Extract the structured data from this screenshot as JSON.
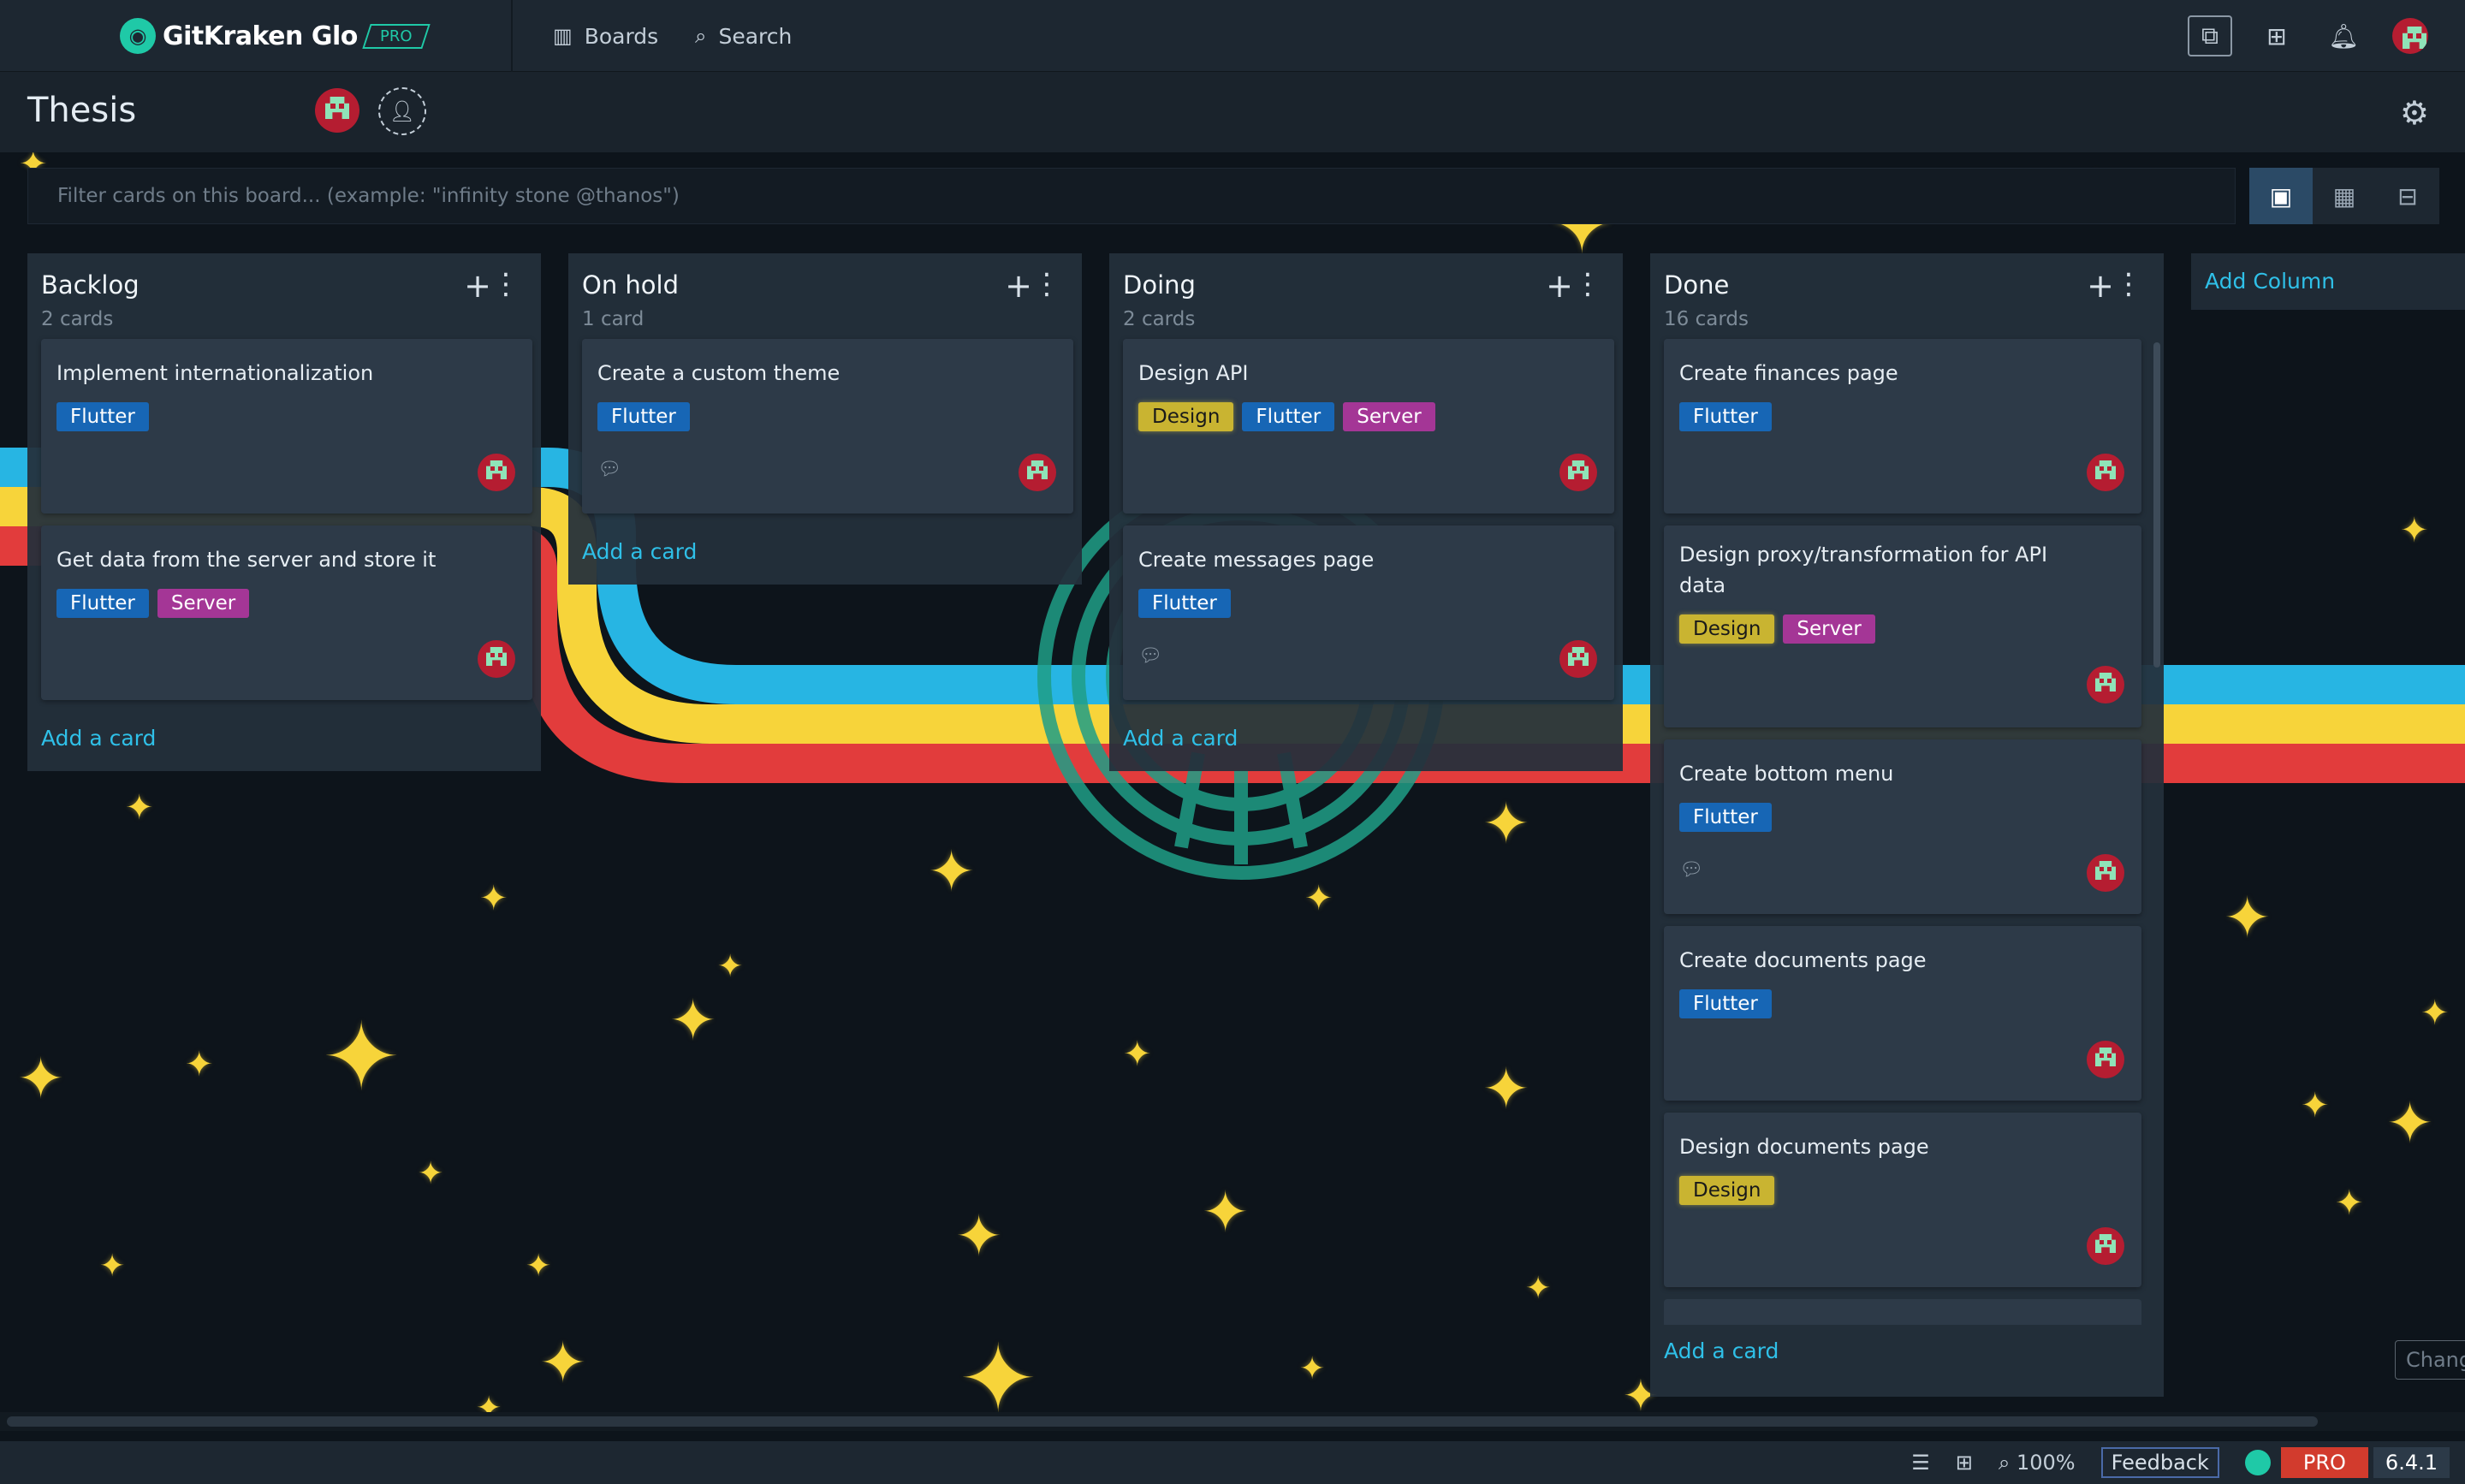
{
  "app": {
    "logo_text": "GitKraken Glo",
    "logo_badge": "PRO"
  },
  "topnav": {
    "boards_label": "Boards",
    "search_label": "Search"
  },
  "board": {
    "title": "Thesis"
  },
  "filter": {
    "placeholder": "Filter cards on this board... (example: \"infinity stone @thanos\")"
  },
  "columns": [
    {
      "title": "Backlog",
      "count": "2 cards",
      "add_card_label": "Add a card",
      "cards": [
        {
          "title": "Implement internationalization",
          "labels": [
            "Flutter"
          ]
        },
        {
          "title": "Get data from the server and store it",
          "labels": [
            "Flutter",
            "Server"
          ]
        }
      ]
    },
    {
      "title": "On hold",
      "count": "1 card",
      "add_card_label": "Add a card",
      "cards": [
        {
          "title": "Create a custom theme",
          "labels": [
            "Flutter"
          ]
        }
      ]
    },
    {
      "title": "Doing",
      "count": "2 cards",
      "add_card_label": "Add a card",
      "cards": [
        {
          "title": "Design API",
          "labels": [
            "Design",
            "Flutter",
            "Server"
          ]
        },
        {
          "title": "Create messages page",
          "labels": [
            "Flutter"
          ]
        }
      ]
    },
    {
      "title": "Done",
      "count": "16 cards",
      "add_card_label": "Add a card",
      "cards": [
        {
          "title": "Create finances page",
          "labels": [
            "Flutter"
          ]
        },
        {
          "title": "Design proxy/transformation for API data",
          "labels": [
            "Design",
            "Server"
          ]
        },
        {
          "title": "Create bottom menu",
          "labels": [
            "Flutter"
          ]
        },
        {
          "title": "Create documents page",
          "labels": [
            "Flutter"
          ]
        },
        {
          "title": "Design documents page",
          "labels": [
            "Design"
          ]
        }
      ]
    }
  ],
  "add_column_label": "Add Column",
  "statusbar": {
    "zoom": "100%",
    "feedback_label": "Feedback",
    "pro_label": "PRO",
    "version": "6.4.1"
  },
  "change_tab_label": "Chang",
  "colors": {
    "accent": "#2fc0e8",
    "brand": "#1fc9a7",
    "flutter_label": "#1766b5",
    "server_label": "#a43696",
    "design_label": "#c9b431",
    "pro_badge": "#d23b2d",
    "rainbow": [
      "#27b5e3",
      "#f7d43a",
      "#e23c3c"
    ]
  },
  "icons": {
    "boards": "columns-icon",
    "search": "search-icon",
    "open_external": "external-link-icon",
    "gift": "gift-icon",
    "notifications": "bell-icon",
    "settings": "gear-icon",
    "add_member": "add-user-icon",
    "view_board": "board-view-icon",
    "view_calendar": "calendar-icon",
    "view_timeline": "timeline-icon"
  }
}
